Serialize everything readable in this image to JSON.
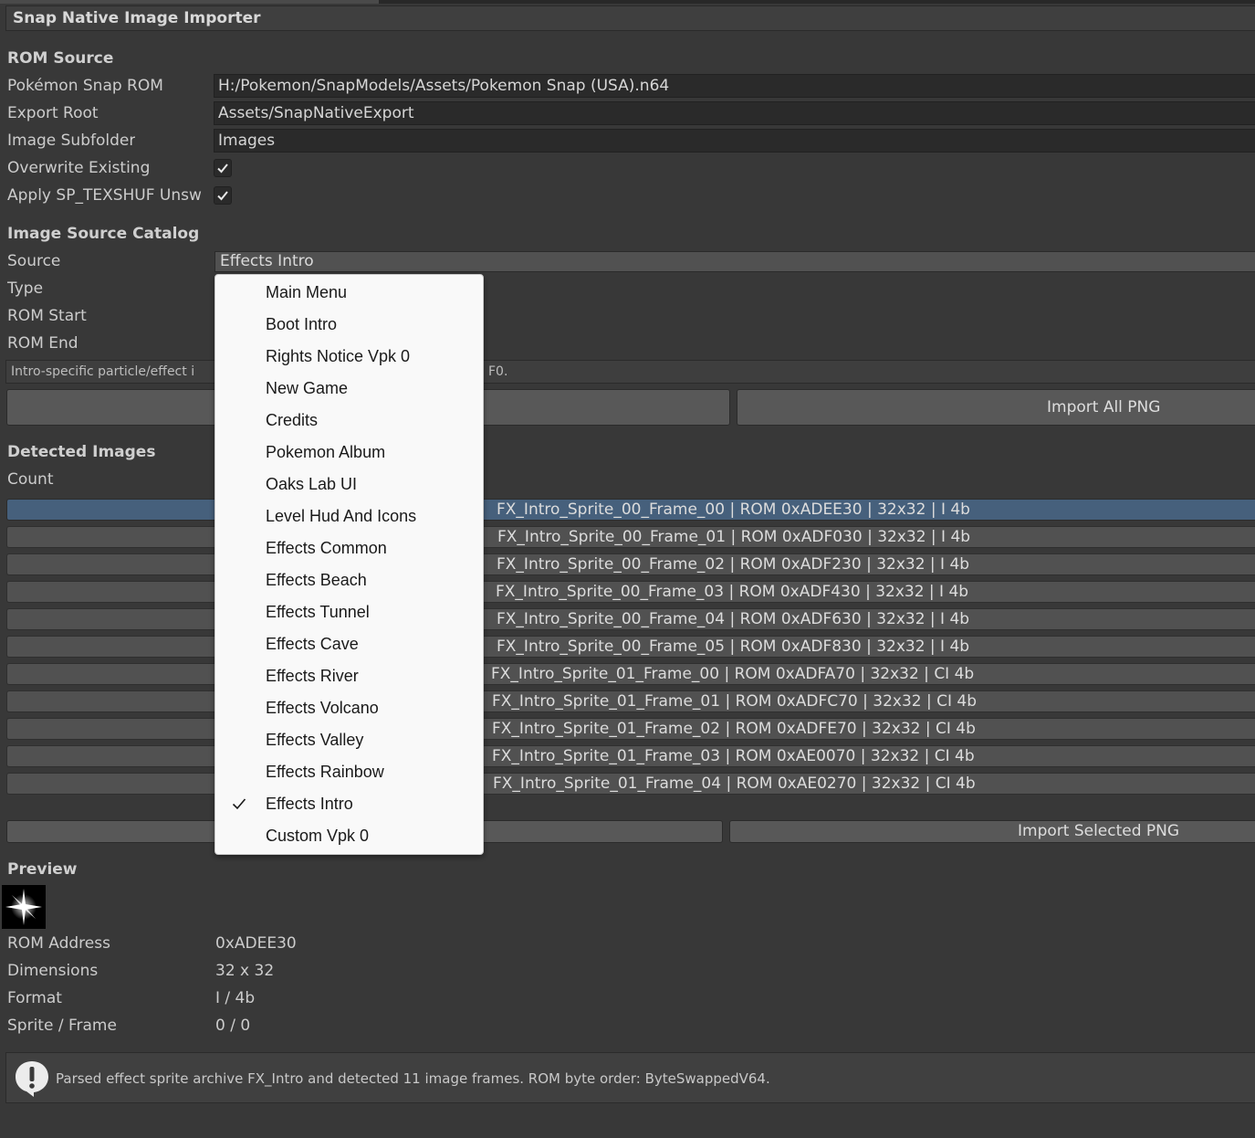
{
  "window": {
    "title": "Snap Native Image Importer"
  },
  "rom_source": {
    "heading": "ROM Source",
    "rom_label": "Pokémon Snap ROM",
    "rom_value": "H:/Pokemon/SnapModels/Assets/Pokemon Snap (USA).n64",
    "export_root_label": "Export Root",
    "export_root_value": "Assets/SnapNativeExport",
    "image_subfolder_label": "Image Subfolder",
    "image_subfolder_value": "Images",
    "overwrite_label": "Overwrite Existing",
    "overwrite_checked": true,
    "texshuf_label": "Apply SP_TEXSHUF Unsw",
    "texshuf_checked": true
  },
  "catalog": {
    "heading": "Image Source Catalog",
    "source_label": "Source",
    "source_value": "Effects Intro",
    "type_label": "Type",
    "rom_start_label": "ROM Start",
    "rom_end_label": "ROM End",
    "help_left": "Intro-specific particle/effect i",
    "help_right": "F0.",
    "import_all_label": "Import All PNG"
  },
  "detected": {
    "heading": "Detected Images",
    "count_label": "Count",
    "rows": [
      "FX_Intro_Sprite_00_Frame_00 | ROM 0xADEE30 | 32x32 | I 4b",
      "FX_Intro_Sprite_00_Frame_01 | ROM 0xADF030 | 32x32 | I 4b",
      "FX_Intro_Sprite_00_Frame_02 | ROM 0xADF230 | 32x32 | I 4b",
      "FX_Intro_Sprite_00_Frame_03 | ROM 0xADF430 | 32x32 | I 4b",
      "FX_Intro_Sprite_00_Frame_04 | ROM 0xADF630 | 32x32 | I 4b",
      "FX_Intro_Sprite_00_Frame_05 | ROM 0xADF830 | 32x32 | I 4b",
      "FX_Intro_Sprite_01_Frame_00 | ROM 0xADFA70 | 32x32 | CI 4b",
      "FX_Intro_Sprite_01_Frame_01 | ROM 0xADFC70 | 32x32 | CI 4b",
      "FX_Intro_Sprite_01_Frame_02 | ROM 0xADFE70 | 32x32 | CI 4b",
      "FX_Intro_Sprite_01_Frame_03 | ROM 0xAE0070 | 32x32 | CI 4b",
      "FX_Intro_Sprite_01_Frame_04 | ROM 0xAE0270 | 32x32 | CI 4b"
    ],
    "import_selected_label": "Import Selected PNG"
  },
  "preview": {
    "heading": "Preview",
    "rom_address_label": "ROM Address",
    "rom_address_value": "0xADEE30",
    "dimensions_label": "Dimensions",
    "dimensions_value": "32 x 32",
    "format_label": "Format",
    "format_value": "I / 4b",
    "sprite_frame_label": "Sprite / Frame",
    "sprite_frame_value": "0 / 0"
  },
  "status": {
    "message": "Parsed effect sprite archive FX_Intro and detected 11 image frames. ROM byte order: ByteSwappedV64."
  },
  "source_menu": {
    "items": [
      "Main Menu",
      "Boot Intro",
      "Rights Notice Vpk 0",
      "New Game",
      "Credits",
      "Pokemon Album",
      "Oaks Lab UI",
      "Level Hud And Icons",
      "Effects Common",
      "Effects Beach",
      "Effects Tunnel",
      "Effects Cave",
      "Effects River",
      "Effects Volcano",
      "Effects Valley",
      "Effects Rainbow",
      "Effects Intro",
      "Custom Vpk 0"
    ],
    "selected_index": 16
  },
  "colors": {
    "background": "#383838",
    "selected_row": "#46607c",
    "menu_background": "#f9f9f9"
  }
}
